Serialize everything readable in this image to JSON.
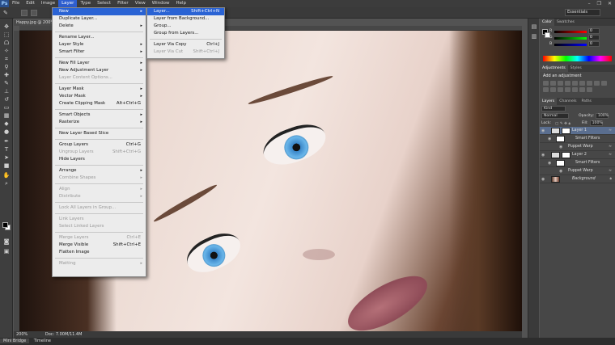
{
  "menubar": {
    "logo": "Ps",
    "items": [
      "File",
      "Edit",
      "Image",
      "Layer",
      "Type",
      "Select",
      "Filter",
      "View",
      "Window",
      "Help"
    ],
    "active": "Layer",
    "window_controls": [
      "–",
      "❐",
      "✕"
    ]
  },
  "options": {
    "workspace": "Essentials"
  },
  "document": {
    "tab_label": "Happy.jpg @ 200% (Layer 1, RGB/8) *",
    "status_zoom": "200%",
    "status_doc": "Doc: 7.00M/11.4M"
  },
  "bottombar": {
    "tabs": [
      "Mini Bridge",
      "Timeline"
    ]
  },
  "layer_menu": {
    "groups": [
      [
        {
          "label": "New",
          "arrow": true,
          "highlight": true
        },
        {
          "label": "Duplicate Layer..."
        },
        {
          "label": "Delete",
          "arrow": true
        }
      ],
      [
        {
          "label": "Rename Layer..."
        },
        {
          "label": "Layer Style",
          "arrow": true
        },
        {
          "label": "Smart Filter",
          "arrow": true
        }
      ],
      [
        {
          "label": "New Fill Layer",
          "arrow": true
        },
        {
          "label": "New Adjustment Layer",
          "arrow": true
        },
        {
          "label": "Layer Content Options...",
          "disabled": true
        }
      ],
      [
        {
          "label": "Layer Mask",
          "arrow": true
        },
        {
          "label": "Vector Mask",
          "arrow": true
        },
        {
          "label": "Create Clipping Mask",
          "shortcut": "Alt+Ctrl+G"
        }
      ],
      [
        {
          "label": "Smart Objects",
          "arrow": true
        },
        {
          "label": "Rasterize",
          "arrow": true
        }
      ],
      [
        {
          "label": "New Layer Based Slice"
        }
      ],
      [
        {
          "label": "Group Layers",
          "shortcut": "Ctrl+G"
        },
        {
          "label": "Ungroup Layers",
          "shortcut": "Shift+Ctrl+G",
          "disabled": true
        },
        {
          "label": "Hide Layers"
        }
      ],
      [
        {
          "label": "Arrange",
          "arrow": true
        },
        {
          "label": "Combine Shapes",
          "arrow": true,
          "disabled": true
        }
      ],
      [
        {
          "label": "Align",
          "arrow": true,
          "disabled": true
        },
        {
          "label": "Distribute",
          "arrow": true,
          "disabled": true
        }
      ],
      [
        {
          "label": "Lock All Layers in Group...",
          "disabled": true
        }
      ],
      [
        {
          "label": "Link Layers",
          "disabled": true
        },
        {
          "label": "Select Linked Layers",
          "disabled": true
        }
      ],
      [
        {
          "label": "Merge Layers",
          "shortcut": "Ctrl+E",
          "disabled": true
        },
        {
          "label": "Merge Visible",
          "shortcut": "Shift+Ctrl+E"
        },
        {
          "label": "Flatten Image"
        }
      ],
      [
        {
          "label": "Matting",
          "arrow": true,
          "disabled": true
        }
      ]
    ]
  },
  "new_submenu": {
    "groups": [
      [
        {
          "label": "Layer...",
          "shortcut": "Shift+Ctrl+N",
          "highlight": true
        },
        {
          "label": "Layer from Background..."
        },
        {
          "label": "Group..."
        },
        {
          "label": "Group from Layers..."
        }
      ],
      [
        {
          "label": "Layer Via Copy",
          "shortcut": "Ctrl+J"
        },
        {
          "label": "Layer Via Cut",
          "shortcut": "Shift+Ctrl+J",
          "disabled": true
        }
      ]
    ]
  },
  "color_panel": {
    "tabs": [
      "Color",
      "Swatches"
    ],
    "channels": [
      {
        "label": "R",
        "value": "0"
      },
      {
        "label": "G",
        "value": "0"
      },
      {
        "label": "B",
        "value": "0"
      }
    ]
  },
  "adjustments_panel": {
    "tabs": [
      "Adjustments",
      "Styles"
    ],
    "title": "Add an adjustment"
  },
  "layers_panel": {
    "tabs": [
      "Layers",
      "Channels",
      "Paths"
    ],
    "kind": "Kind",
    "blend_mode": "Normal",
    "opacity_label": "Opacity:",
    "opacity_value": "100%",
    "lock_label": "Lock:",
    "fill_label": "Fill:",
    "fill_value": "100%",
    "layers": [
      {
        "name": "Layer 1",
        "selected": true,
        "type": "smart"
      },
      {
        "name": "Smart Filters",
        "type": "filters"
      },
      {
        "name": "Puppet Warp",
        "type": "filter"
      },
      {
        "name": "Layer 2",
        "type": "smart"
      },
      {
        "name": "Smart Filters",
        "type": "filters"
      },
      {
        "name": "Puppet Warp",
        "type": "filter"
      },
      {
        "name": "Background",
        "type": "background",
        "italic": true
      }
    ]
  }
}
